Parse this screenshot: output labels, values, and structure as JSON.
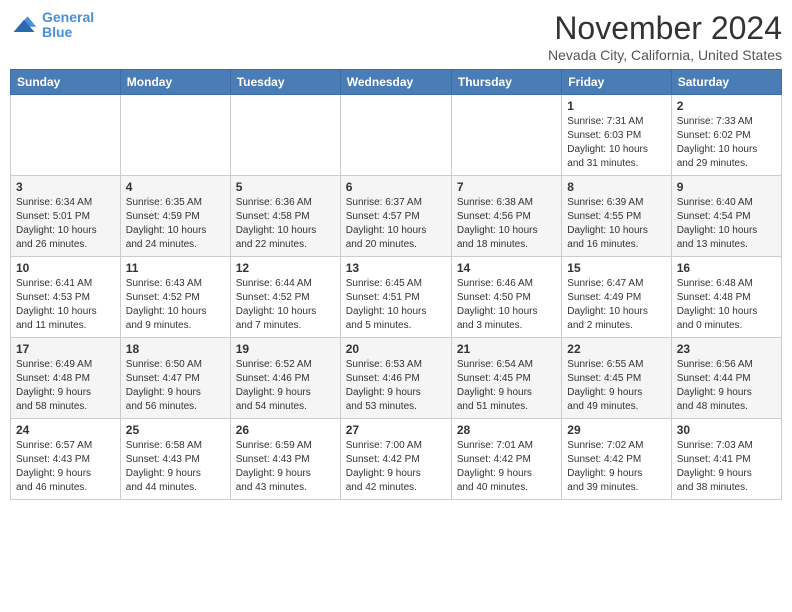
{
  "header": {
    "logo_line1": "General",
    "logo_line2": "Blue",
    "month": "November 2024",
    "location": "Nevada City, California, United States"
  },
  "weekdays": [
    "Sunday",
    "Monday",
    "Tuesday",
    "Wednesday",
    "Thursday",
    "Friday",
    "Saturday"
  ],
  "weeks": [
    [
      {
        "day": "",
        "info": ""
      },
      {
        "day": "",
        "info": ""
      },
      {
        "day": "",
        "info": ""
      },
      {
        "day": "",
        "info": ""
      },
      {
        "day": "",
        "info": ""
      },
      {
        "day": "1",
        "info": "Sunrise: 7:31 AM\nSunset: 6:03 PM\nDaylight: 10 hours\nand 31 minutes."
      },
      {
        "day": "2",
        "info": "Sunrise: 7:33 AM\nSunset: 6:02 PM\nDaylight: 10 hours\nand 29 minutes."
      }
    ],
    [
      {
        "day": "3",
        "info": "Sunrise: 6:34 AM\nSunset: 5:01 PM\nDaylight: 10 hours\nand 26 minutes."
      },
      {
        "day": "4",
        "info": "Sunrise: 6:35 AM\nSunset: 4:59 PM\nDaylight: 10 hours\nand 24 minutes."
      },
      {
        "day": "5",
        "info": "Sunrise: 6:36 AM\nSunset: 4:58 PM\nDaylight: 10 hours\nand 22 minutes."
      },
      {
        "day": "6",
        "info": "Sunrise: 6:37 AM\nSunset: 4:57 PM\nDaylight: 10 hours\nand 20 minutes."
      },
      {
        "day": "7",
        "info": "Sunrise: 6:38 AM\nSunset: 4:56 PM\nDaylight: 10 hours\nand 18 minutes."
      },
      {
        "day": "8",
        "info": "Sunrise: 6:39 AM\nSunset: 4:55 PM\nDaylight: 10 hours\nand 16 minutes."
      },
      {
        "day": "9",
        "info": "Sunrise: 6:40 AM\nSunset: 4:54 PM\nDaylight: 10 hours\nand 13 minutes."
      }
    ],
    [
      {
        "day": "10",
        "info": "Sunrise: 6:41 AM\nSunset: 4:53 PM\nDaylight: 10 hours\nand 11 minutes."
      },
      {
        "day": "11",
        "info": "Sunrise: 6:43 AM\nSunset: 4:52 PM\nDaylight: 10 hours\nand 9 minutes."
      },
      {
        "day": "12",
        "info": "Sunrise: 6:44 AM\nSunset: 4:52 PM\nDaylight: 10 hours\nand 7 minutes."
      },
      {
        "day": "13",
        "info": "Sunrise: 6:45 AM\nSunset: 4:51 PM\nDaylight: 10 hours\nand 5 minutes."
      },
      {
        "day": "14",
        "info": "Sunrise: 6:46 AM\nSunset: 4:50 PM\nDaylight: 10 hours\nand 3 minutes."
      },
      {
        "day": "15",
        "info": "Sunrise: 6:47 AM\nSunset: 4:49 PM\nDaylight: 10 hours\nand 2 minutes."
      },
      {
        "day": "16",
        "info": "Sunrise: 6:48 AM\nSunset: 4:48 PM\nDaylight: 10 hours\nand 0 minutes."
      }
    ],
    [
      {
        "day": "17",
        "info": "Sunrise: 6:49 AM\nSunset: 4:48 PM\nDaylight: 9 hours\nand 58 minutes."
      },
      {
        "day": "18",
        "info": "Sunrise: 6:50 AM\nSunset: 4:47 PM\nDaylight: 9 hours\nand 56 minutes."
      },
      {
        "day": "19",
        "info": "Sunrise: 6:52 AM\nSunset: 4:46 PM\nDaylight: 9 hours\nand 54 minutes."
      },
      {
        "day": "20",
        "info": "Sunrise: 6:53 AM\nSunset: 4:46 PM\nDaylight: 9 hours\nand 53 minutes."
      },
      {
        "day": "21",
        "info": "Sunrise: 6:54 AM\nSunset: 4:45 PM\nDaylight: 9 hours\nand 51 minutes."
      },
      {
        "day": "22",
        "info": "Sunrise: 6:55 AM\nSunset: 4:45 PM\nDaylight: 9 hours\nand 49 minutes."
      },
      {
        "day": "23",
        "info": "Sunrise: 6:56 AM\nSunset: 4:44 PM\nDaylight: 9 hours\nand 48 minutes."
      }
    ],
    [
      {
        "day": "24",
        "info": "Sunrise: 6:57 AM\nSunset: 4:43 PM\nDaylight: 9 hours\nand 46 minutes."
      },
      {
        "day": "25",
        "info": "Sunrise: 6:58 AM\nSunset: 4:43 PM\nDaylight: 9 hours\nand 44 minutes."
      },
      {
        "day": "26",
        "info": "Sunrise: 6:59 AM\nSunset: 4:43 PM\nDaylight: 9 hours\nand 43 minutes."
      },
      {
        "day": "27",
        "info": "Sunrise: 7:00 AM\nSunset: 4:42 PM\nDaylight: 9 hours\nand 42 minutes."
      },
      {
        "day": "28",
        "info": "Sunrise: 7:01 AM\nSunset: 4:42 PM\nDaylight: 9 hours\nand 40 minutes."
      },
      {
        "day": "29",
        "info": "Sunrise: 7:02 AM\nSunset: 4:42 PM\nDaylight: 9 hours\nand 39 minutes."
      },
      {
        "day": "30",
        "info": "Sunrise: 7:03 AM\nSunset: 4:41 PM\nDaylight: 9 hours\nand 38 minutes."
      }
    ]
  ]
}
